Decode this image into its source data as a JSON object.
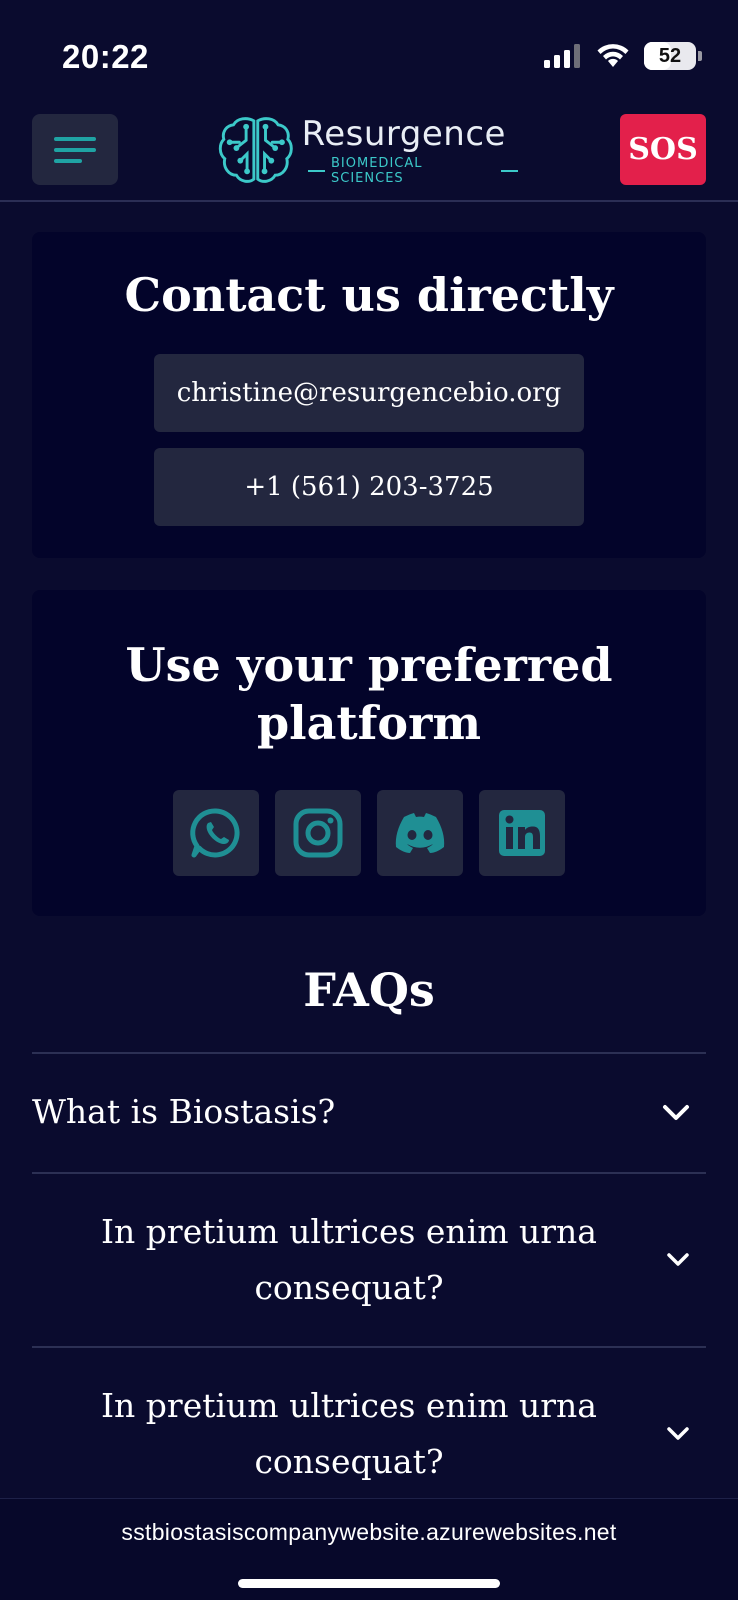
{
  "status_bar": {
    "time": "20:22",
    "battery_level": "52",
    "battery_fraction": 0.52,
    "signal_icon": "cellular-signal-icon",
    "wifi_icon": "wifi-icon"
  },
  "header": {
    "menu_icon": "hamburger-menu-icon",
    "logo_name": "Resurgence",
    "logo_subtitle": "BIOMEDICAL SCIENCES",
    "logo_icon": "brain-circuit-icon",
    "sos_label": "SOS"
  },
  "contact": {
    "title": "Contact us directly",
    "email": "christine@resurgencebio.org",
    "phone": "+1 (561) 203-3725"
  },
  "platforms": {
    "title": "Use your preferred platform",
    "items": [
      {
        "name": "WhatsApp",
        "icon": "whatsapp-icon"
      },
      {
        "name": "Instagram",
        "icon": "instagram-icon"
      },
      {
        "name": "Discord",
        "icon": "discord-icon"
      },
      {
        "name": "LinkedIn",
        "icon": "linkedin-icon"
      }
    ]
  },
  "faq": {
    "title": "FAQs",
    "items": [
      {
        "question": "What is Biostasis?"
      },
      {
        "question": "In pretium ultrices enim urna consequat?"
      },
      {
        "question": "In pretium ultrices enim urna consequat?"
      }
    ]
  },
  "browser": {
    "url": "sstbiostasiscompanywebsite.azurewebsites.net"
  },
  "colors": {
    "background": "#0a0b2e",
    "card": "#03042a",
    "button": "#23273f",
    "accent_teal": "#1fa3a3",
    "sos_red": "#e3204b"
  }
}
